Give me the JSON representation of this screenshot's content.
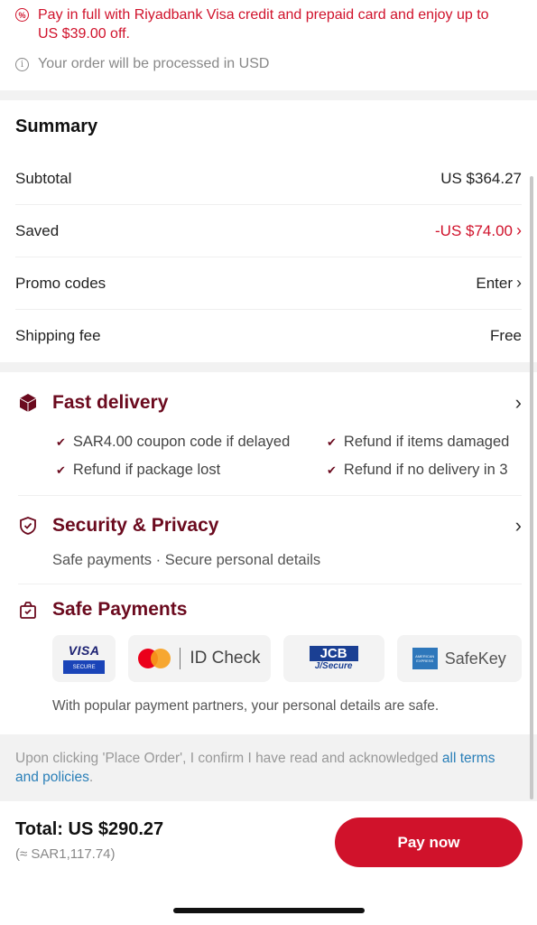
{
  "promo": {
    "icon": "percent-badge-icon",
    "text": "Pay in full with Riyadbank Visa credit and prepaid card and enjoy up to US $39.00 off.",
    "currency_note": "Your order will be processed in USD"
  },
  "summary": {
    "title": "Summary",
    "rows": [
      {
        "label": "Subtotal",
        "value": "US $364.27"
      },
      {
        "label": "Saved",
        "value": "-US $74.00"
      },
      {
        "label": "Promo codes",
        "value": "Enter"
      },
      {
        "label": "Shipping fee",
        "value": "Free"
      }
    ]
  },
  "fast_delivery": {
    "title": "Fast delivery",
    "bullets": [
      "SAR4.00 coupon code if delayed",
      "Refund if items damaged",
      "Refund if package lost",
      "Refund if no delivery in 3"
    ]
  },
  "security": {
    "title": "Security & Privacy",
    "subtitle": "Safe payments · Secure personal details"
  },
  "safe_payments": {
    "title": "Safe Payments",
    "cards": {
      "visa": "VISA",
      "visa_secure": "SECURE",
      "mastercard": "ID Check",
      "jcb": "JCB",
      "jcb_sub": "J/Secure",
      "amex_box": "AMERICAN EXPRESS",
      "amex": "SafeKey"
    },
    "note": "With popular payment partners, your personal details are safe."
  },
  "terms": {
    "text": "Upon clicking 'Place Order', I confirm I have read and acknowledged ",
    "link": "all terms and policies",
    "end": "."
  },
  "footer": {
    "total": "Total: US $290.27",
    "total_sar": "(≈ SAR1,117.74)",
    "pay_label": "Pay now"
  },
  "colors": {
    "accent": "#d0122b",
    "section_title": "#6b0a1e",
    "link": "#2a7fb8"
  }
}
